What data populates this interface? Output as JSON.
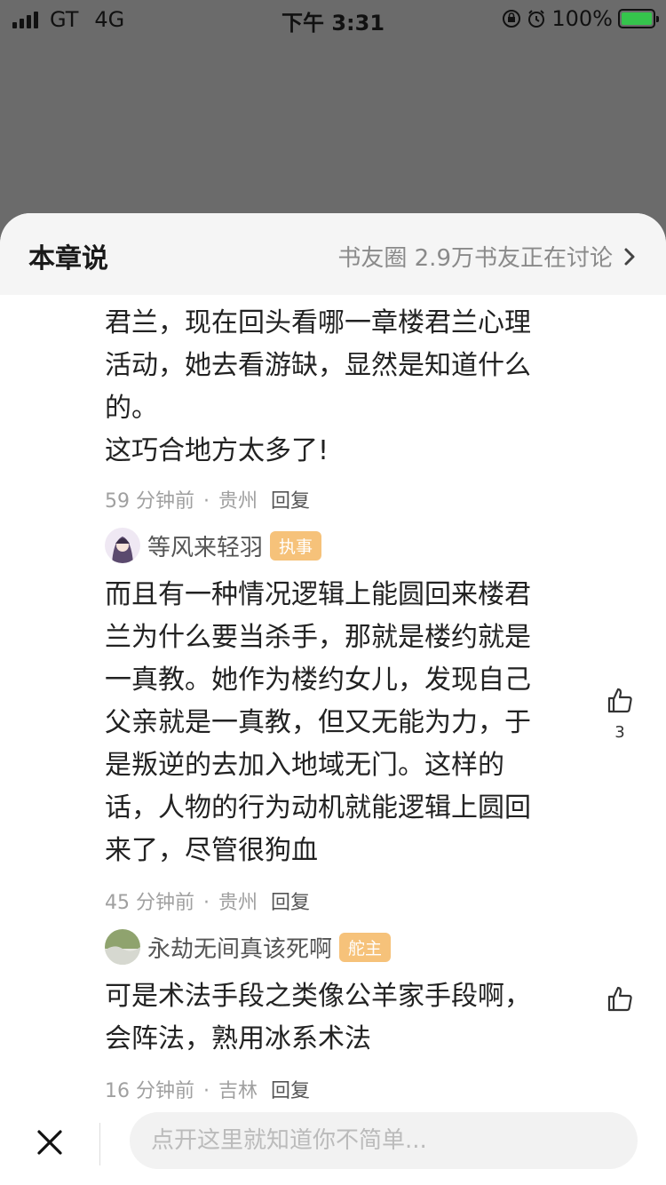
{
  "status": {
    "carrier": "GT",
    "network": "4G",
    "time": "下午 3:31",
    "battery": "100%"
  },
  "sheet": {
    "title": "本章说",
    "link": "书友圈 2.9万书友正在讨论"
  },
  "comments": [
    {
      "text_lines": [
        "君兰，现在回头看哪一章楼君兰心理",
        "活动，她去看游缺，显然是知道什么",
        "的。",
        "这巧合地方太多了!"
      ],
      "time": "59 分钟前",
      "location": "贵州",
      "reply": "回复"
    },
    {
      "user": "等风来轻羽",
      "badge": "执事",
      "text_lines": [
        "而且有一种情况逻辑上能圆回来楼君",
        "兰为什么要当杀手，那就是楼约就是",
        "一真教。她作为楼约女儿，发现自己",
        "父亲就是一真教，但又无能为力，于",
        "是叛逆的去加入地域无门。这样的",
        "话，人物的行为动机就能逻辑上圆回",
        "来了，尽管很狗血"
      ],
      "likes": "3",
      "time": "45 分钟前",
      "location": "贵州",
      "reply": "回复"
    },
    {
      "user": "永劫无间真该死啊",
      "badge": "舵主",
      "text_lines": [
        "可是术法手段之类像公羊家手段啊，",
        "会阵法，熟用冰系术法"
      ],
      "time": "16 分钟前",
      "location": "吉林",
      "reply": "回复"
    }
  ],
  "input": {
    "placeholder": "点开这里就知道你不简单..."
  },
  "colors": {
    "badge": "#f6c27a",
    "overlay": "#6b6b6b",
    "battery": "#35c44c"
  }
}
